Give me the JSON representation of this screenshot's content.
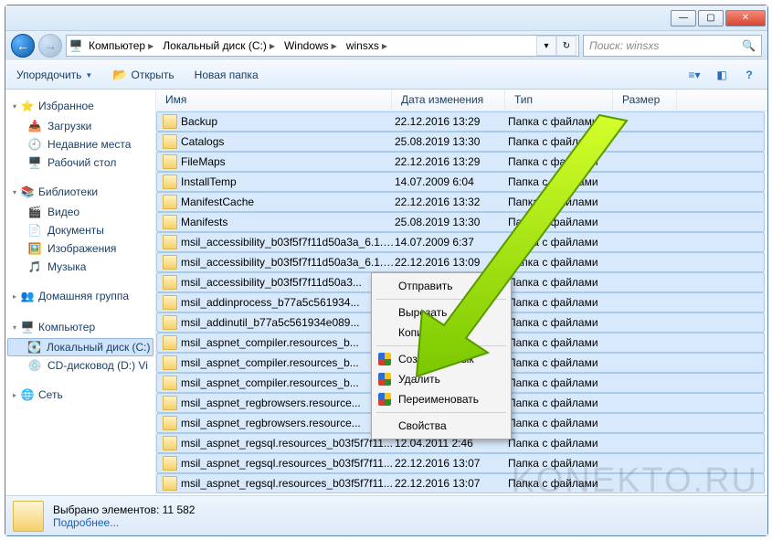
{
  "window_controls": {
    "min": "—",
    "max": "▢",
    "close": "✕"
  },
  "nav": {
    "back": "←",
    "fwd": "→"
  },
  "breadcrumbs": [
    {
      "label": "Компьютер"
    },
    {
      "label": "Локальный диск (C:)"
    },
    {
      "label": "Windows"
    },
    {
      "label": "winsxs"
    }
  ],
  "search": {
    "placeholder": "Поиск: winsxs"
  },
  "toolbar": {
    "organize": "Упорядочить",
    "open": "Открыть",
    "newfolder": "Новая папка"
  },
  "columns": {
    "name": "Имя",
    "date": "Дата изменения",
    "type": "Тип",
    "size": "Размер"
  },
  "sidebar": {
    "favorites": {
      "head": "Избранное",
      "items": [
        "Загрузки",
        "Недавние места",
        "Рабочий стол"
      ]
    },
    "libraries": {
      "head": "Библиотеки",
      "items": [
        "Видео",
        "Документы",
        "Изображения",
        "Музыка"
      ]
    },
    "homegroup": {
      "head": "Домашняя группа"
    },
    "computer": {
      "head": "Компьютер",
      "items": [
        "Локальный диск (C:)",
        "CD-дисковод (D:) Vi"
      ]
    },
    "network": {
      "head": "Сеть"
    }
  },
  "rows": [
    {
      "name": "Backup",
      "date": "22.12.2016 13:29",
      "type": "Папка с файлами"
    },
    {
      "name": "Catalogs",
      "date": "25.08.2019 13:30",
      "type": "Папка с файлами"
    },
    {
      "name": "FileMaps",
      "date": "22.12.2016 13:29",
      "type": "Папка с файлами"
    },
    {
      "name": "InstallTemp",
      "date": "14.07.2009 6:04",
      "type": "Папка с файлами"
    },
    {
      "name": "ManifestCache",
      "date": "22.12.2016 13:32",
      "type": "Папка с файлами"
    },
    {
      "name": "Manifests",
      "date": "25.08.2019 13:30",
      "type": "Папка с файлами"
    },
    {
      "name": "msil_accessibility_b03f5f7f11d50a3a_6.1.7...",
      "date": "14.07.2009 6:37",
      "type": "Папка с файлами"
    },
    {
      "name": "msil_accessibility_b03f5f7f11d50a3a_6.1.7...",
      "date": "22.12.2016 13:09",
      "type": "Папка с файлами"
    },
    {
      "name": "msil_accessibility_b03f5f7f11d50a3...",
      "date": "",
      "type": "Папка с файлами"
    },
    {
      "name": "msil_addinprocess_b77a5c561934...",
      "date": "",
      "type": "Папка с файлами"
    },
    {
      "name": "msil_addinutil_b77a5c561934e089...",
      "date": "",
      "type": "Папка с файлами"
    },
    {
      "name": "msil_aspnet_compiler.resources_b...",
      "date": "",
      "type": "Папка с файлами"
    },
    {
      "name": "msil_aspnet_compiler.resources_b...",
      "date": "",
      "type": "Папка с файлами"
    },
    {
      "name": "msil_aspnet_compiler.resources_b...",
      "date": "",
      "type": "Папка с файлами"
    },
    {
      "name": "msil_aspnet_regbrowsers.resource...",
      "date": "",
      "type": "Папка с файлами"
    },
    {
      "name": "msil_aspnet_regbrowsers.resource...",
      "date": "",
      "type": "Папка с файлами"
    },
    {
      "name": "msil_aspnet_regsql.resources_b03f5f7f11...",
      "date": "12.04.2011 2:46",
      "type": "Папка с файлами"
    },
    {
      "name": "msil_aspnet_regsql.resources_b03f5f7f11...",
      "date": "22.12.2016 13:07",
      "type": "Папка с файлами"
    },
    {
      "name": "msil_aspnet_regsql.resources_b03f5f7f11...",
      "date": "22.12.2016 13:07",
      "type": "Папка с файлами"
    }
  ],
  "context": {
    "send": "Отправить",
    "cut": "Вырезать",
    "copy": "Копировать",
    "shortcut": "Создать ярлык",
    "delete": "Удалить",
    "rename": "Переименовать",
    "props": "Свойства"
  },
  "status": {
    "selected": "Выбрано элементов: 11 582",
    "more": "Подробнее..."
  },
  "watermark": "KONEKTO.RU"
}
